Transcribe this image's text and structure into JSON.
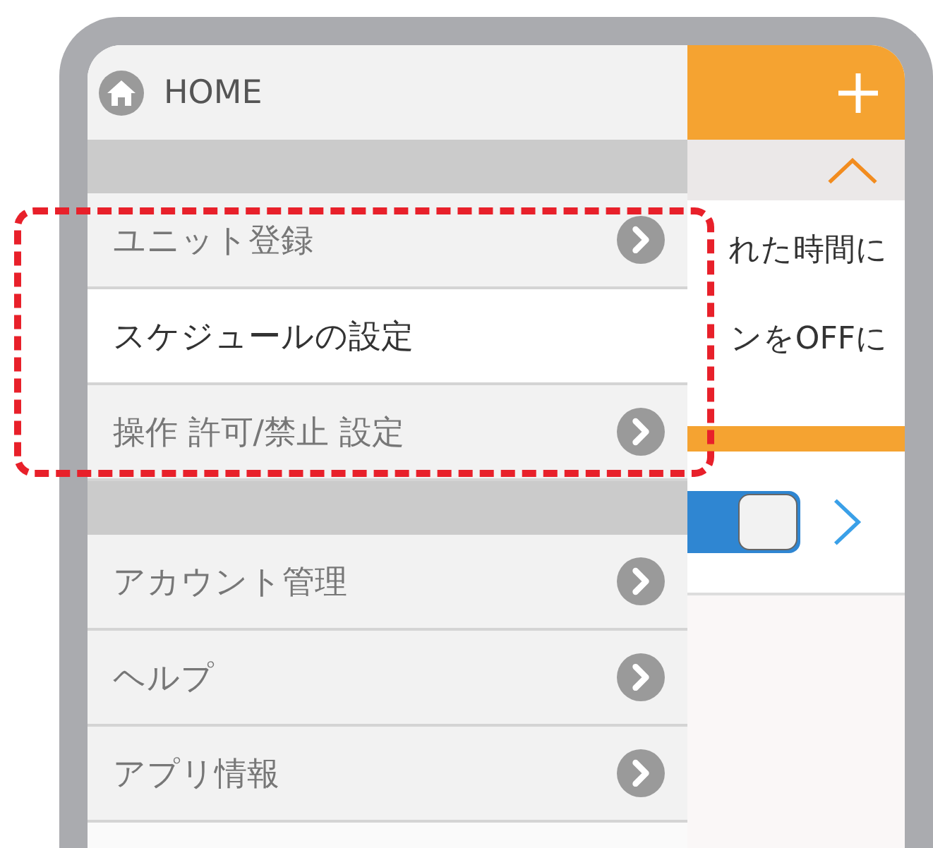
{
  "menu": {
    "home": {
      "label": "HOME"
    },
    "sections": [
      {
        "items": [
          {
            "label": "ユニット登録",
            "selected": false
          },
          {
            "label": "スケジュールの設定",
            "selected": true
          },
          {
            "label": "操作 許可/禁止 設定",
            "selected": false
          }
        ]
      },
      {
        "items": [
          {
            "label": "アカウント管理",
            "selected": false
          },
          {
            "label": "ヘルプ",
            "selected": false
          },
          {
            "label": "アプリ情報",
            "selected": false
          }
        ]
      }
    ]
  },
  "content": {
    "lines": [
      "れた時間に",
      "ンをOFFに"
    ],
    "toggle": {
      "on": true
    }
  }
}
